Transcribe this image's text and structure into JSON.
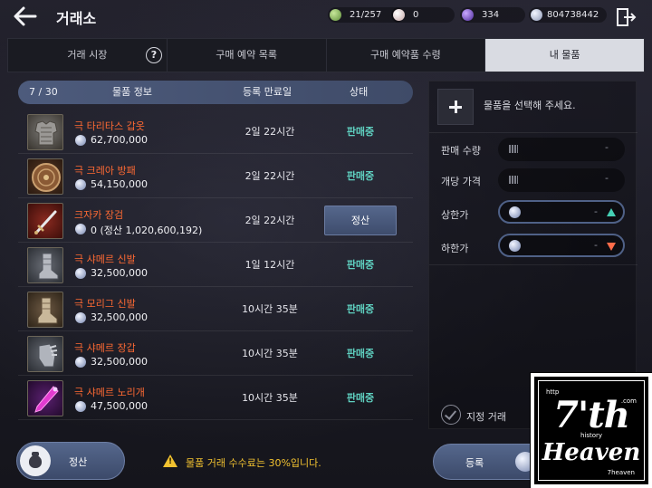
{
  "header": {
    "title": "거래소",
    "resources": [
      {
        "icon": "green-gem-icon",
        "value": "21/257",
        "color": "#7fb35a"
      },
      {
        "icon": "pearl-icon",
        "value": "0",
        "color": "#d9c6c6"
      },
      {
        "icon": "purple-orb-icon",
        "value": "334",
        "color": "#7a4fd6"
      },
      {
        "icon": "silver-coin-icon",
        "value": "804738442",
        "color": "#b8c1d8"
      }
    ]
  },
  "tabs": [
    {
      "label": "거래 시장",
      "active": false
    },
    {
      "label": "구매 예약 목록",
      "active": false
    },
    {
      "label": "구매 예약품 수령",
      "active": false
    },
    {
      "label": "내 물품",
      "active": true
    }
  ],
  "help_symbol": "?",
  "table": {
    "count": "7 / 30",
    "col_item": "물품 정보",
    "col_expire": "등록 만료일",
    "col_status": "상태",
    "rows": [
      {
        "name": "극 타리타스 갑옷",
        "price": "62,700,000",
        "expire": "2일 22시간",
        "status": "판매중",
        "icon": "armor-icon"
      },
      {
        "name": "극 크레아 방패",
        "price": "54,150,000",
        "expire": "2일 22시간",
        "status": "판매중",
        "icon": "shield-icon"
      },
      {
        "name": "크자카 장검",
        "price": "0  (정산 1,020,600,192)",
        "expire": "2일 22시간",
        "status": "정산",
        "icon": "longsword-icon"
      },
      {
        "name": "극 샤메르 신발",
        "price": "32,500,000",
        "expire": "1일 12시간",
        "status": "판매중",
        "icon": "boots-icon"
      },
      {
        "name": "극 모리그 신발",
        "price": "32,500,000",
        "expire": "10시간 35분",
        "status": "판매중",
        "icon": "boots-icon"
      },
      {
        "name": "극 샤메르 장갑",
        "price": "32,500,000",
        "expire": "10시간 35분",
        "status": "판매중",
        "icon": "gloves-icon"
      },
      {
        "name": "극 샤메르 노리개",
        "price": "47,500,000",
        "expire": "10시간 35분",
        "status": "판매중",
        "icon": "norigae-icon"
      }
    ]
  },
  "panel": {
    "select_hint": "물품을 선택해 주세요.",
    "qty_label": "판매 수량",
    "unit_label": "개당 가격",
    "max_label": "상한가",
    "min_label": "하한가",
    "dash": "-",
    "check_label": "지정 거래"
  },
  "bottom": {
    "settle_label": "정산",
    "warn_symbol": "!",
    "fee_notice": "물품 거래 수수료는 30%입니다.",
    "register_label": "등록"
  },
  "watermark": {
    "main": "7'th",
    "sub": "Heaven",
    "small_left": "http",
    "small_right": ".com",
    "small_mid": "history",
    "small_bottom": "7heaven"
  },
  "colors": {
    "item_name": "#ff6a33",
    "status_selling": "#5fd0c0",
    "warning": "#f2c230",
    "accent": "#4f6187"
  }
}
